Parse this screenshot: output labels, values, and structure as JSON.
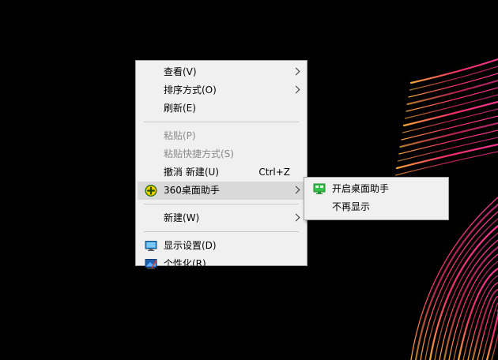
{
  "context_menu": {
    "items": [
      {
        "label": "查看(V)",
        "has_submenu": true
      },
      {
        "label": "排序方式(O)",
        "has_submenu": true
      },
      {
        "label": "刷新(E)"
      },
      {
        "label": "粘贴(P)",
        "disabled": true
      },
      {
        "label": "粘贴快捷方式(S)",
        "disabled": true
      },
      {
        "label": "撤消 新建(U)",
        "shortcut": "Ctrl+Z"
      },
      {
        "label": "360桌面助手",
        "icon": "360-desktop-helper-icon",
        "has_submenu": true,
        "highlighted": true
      },
      {
        "label": "新建(W)",
        "has_submenu": true
      },
      {
        "label": "显示设置(D)",
        "icon": "display-settings-icon"
      },
      {
        "label": "个性化(R)",
        "icon": "personalize-icon"
      }
    ]
  },
  "submenu": {
    "items": [
      {
        "label": "开启桌面助手",
        "icon": "desktop-helper-green-icon"
      },
      {
        "label": "不再显示"
      }
    ]
  },
  "colors": {
    "menu_background": "#f0f0f0",
    "menu_border": "#a0a0a0",
    "highlight": "#d9d9d9",
    "disabled_text": "#8a8a8a",
    "desktop_background": "#000000"
  }
}
